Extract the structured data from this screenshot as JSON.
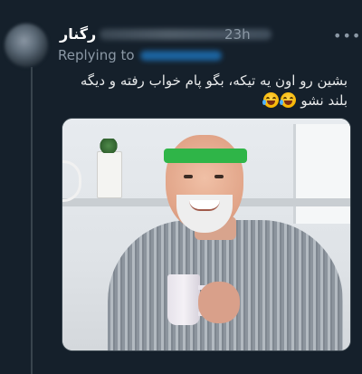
{
  "tweet": {
    "author_name": "رگنار",
    "timestamp": "23h",
    "more_icon": "more-dots-icon",
    "replying_label": "Replying to",
    "text": "بشین رو اون یه تیکه، بگو پام خواب رفته و دیگه بلند نشو"
  },
  "colors": {
    "background": "#15202b",
    "secondary_text": "#8b98a5",
    "headband": "#2fb548"
  }
}
